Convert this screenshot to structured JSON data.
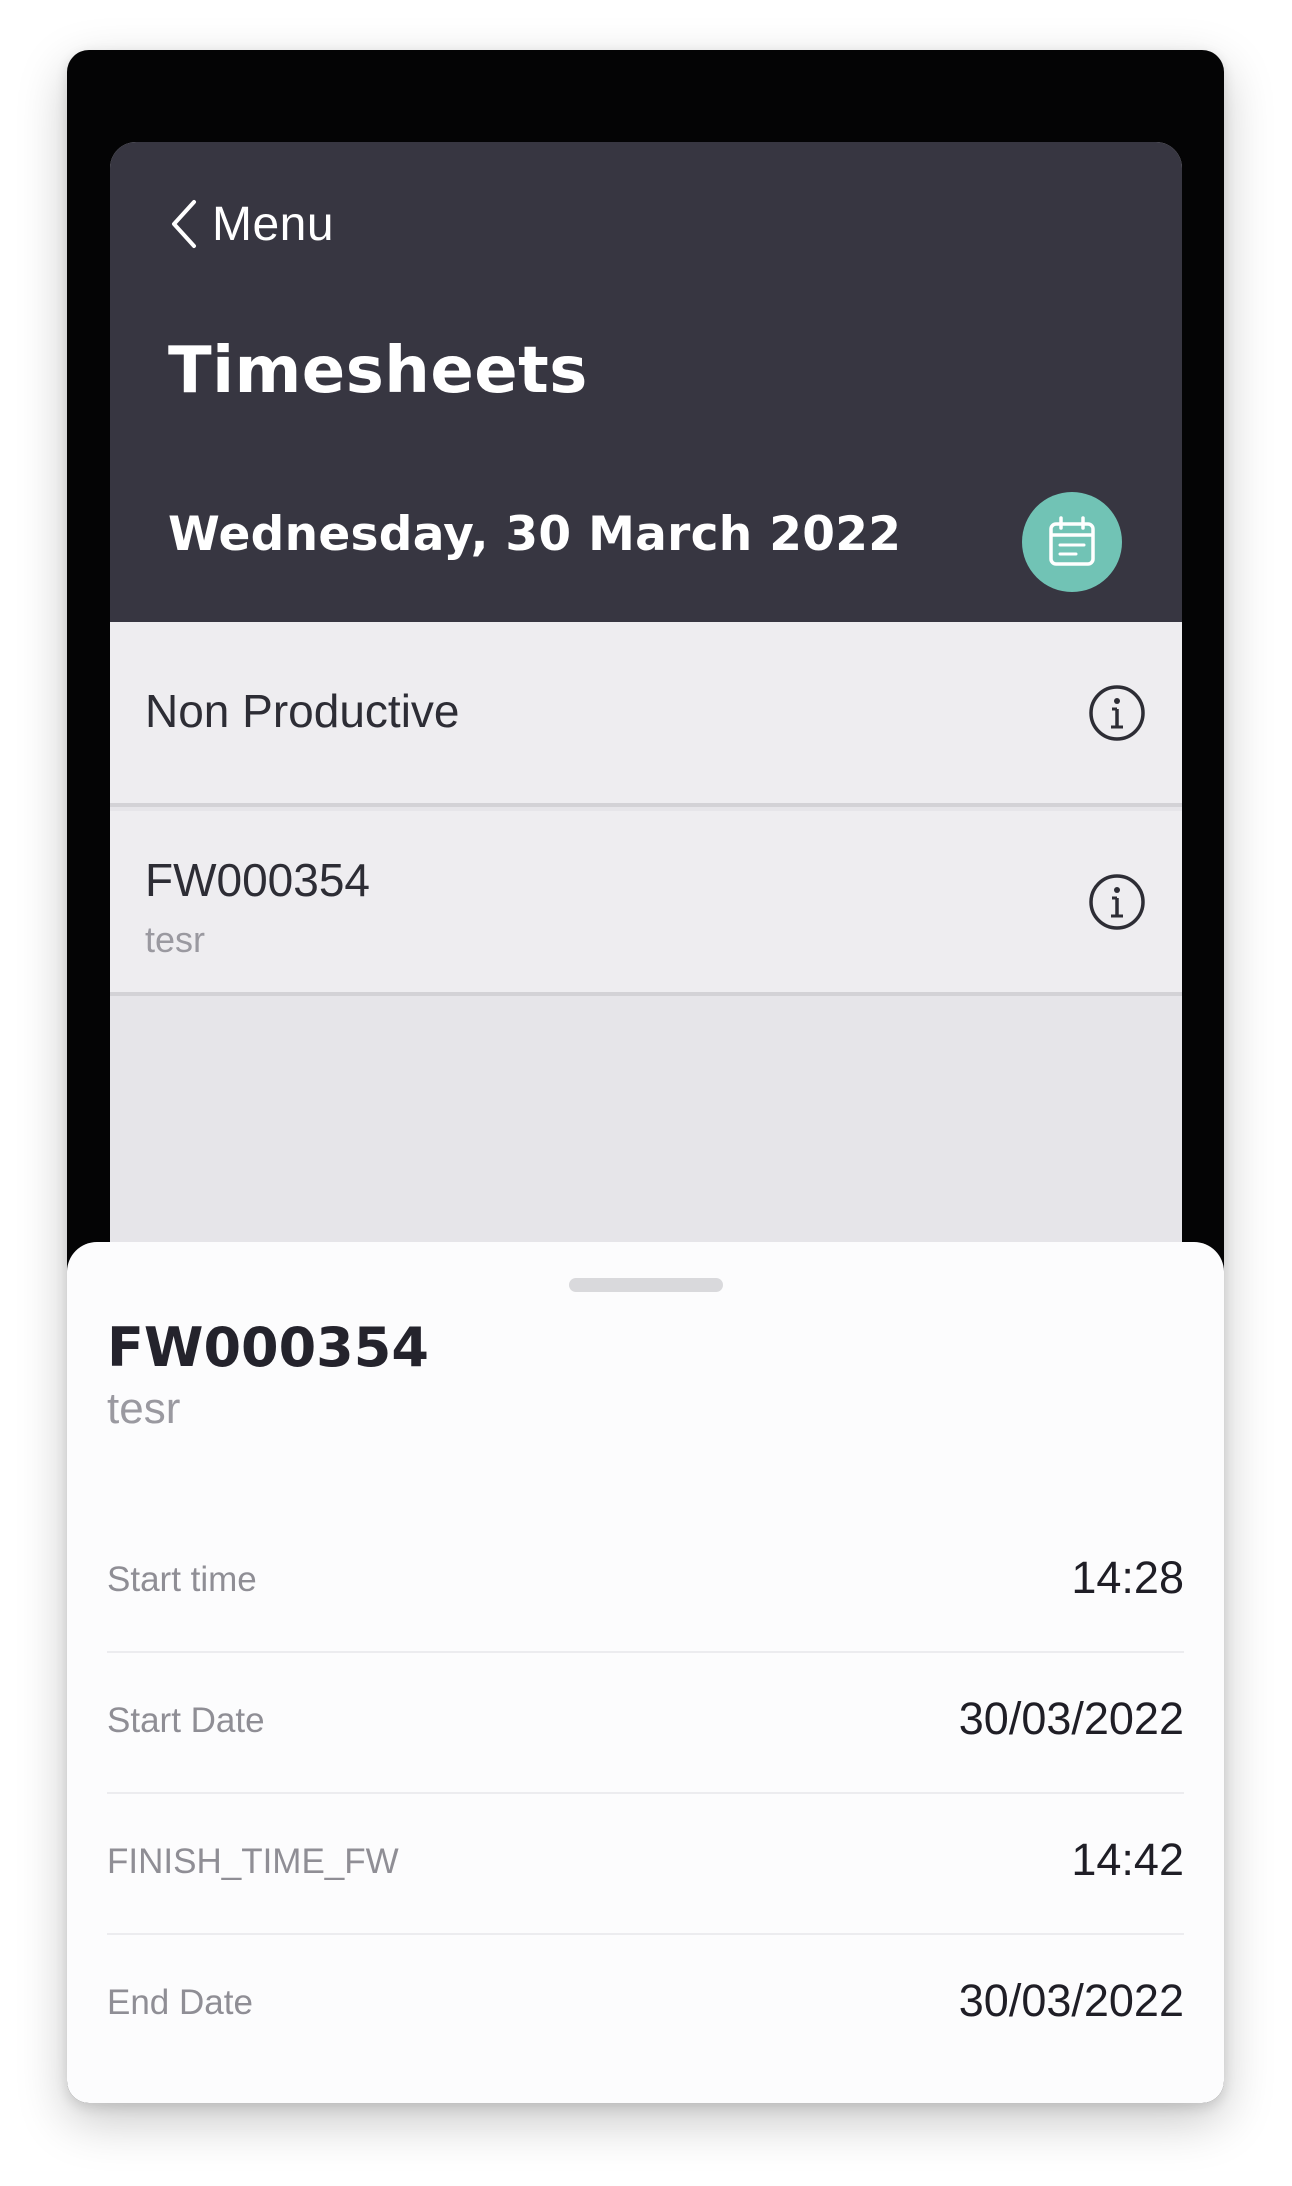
{
  "navigation": {
    "back_label": "Menu"
  },
  "header": {
    "title": "Timesheets",
    "date": "Wednesday, 30 March 2022",
    "calendar_icon": "calendar-icon",
    "accent_color": "#71c3b5",
    "background_color": "#373641"
  },
  "list": {
    "items": [
      {
        "title": "Non Productive",
        "subtitle": "",
        "icon": "info-icon"
      },
      {
        "title": "FW000354",
        "subtitle": "tesr",
        "icon": "info-icon"
      }
    ]
  },
  "sheet": {
    "title": "FW000354",
    "subtitle": "tesr",
    "details": [
      {
        "label": "Start time",
        "value": "14:28"
      },
      {
        "label": "Start Date",
        "value": "30/03/2022"
      },
      {
        "label": "FINISH_TIME_FW",
        "value": "14:42"
      },
      {
        "label": "End Date",
        "value": "30/03/2022"
      }
    ]
  }
}
